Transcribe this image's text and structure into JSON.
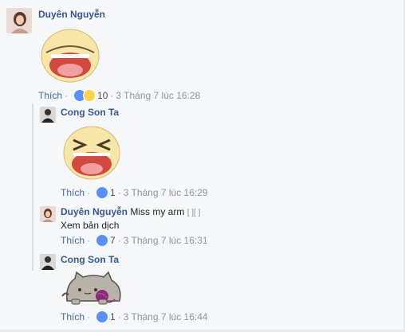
{
  "comments": [
    {
      "author": "Duyên Nguyễn",
      "like_label": "Thích",
      "reaction_count": "10",
      "timestamp": "3 Tháng 7 lúc 16:28",
      "sticker": "laughing-face-sticker"
    },
    {
      "author": "Cong Son Ta",
      "like_label": "Thích",
      "reaction_count": "1",
      "timestamp": "3 Tháng 7 lúc 16:29",
      "sticker": "squinting-laugh-face-sticker"
    },
    {
      "author": "Duyên Nguyễn",
      "text": "Miss my arm",
      "text_suffix": "[ ][ ]",
      "translate_label": "Xem bản dịch",
      "like_label": "Thích",
      "reaction_count": "7",
      "timestamp": "3 Tháng 7 lúc 16:31"
    },
    {
      "author": "Cong Son Ta",
      "like_label": "Thích",
      "reaction_count": "1",
      "timestamp": "3 Tháng 7 lúc 16:44",
      "sticker": "pusheen-cat-yarn-sticker"
    }
  ],
  "separator": "·",
  "colors": {
    "background": "#f6f7f9",
    "name": "#365899",
    "link": "#4267b2",
    "meta": "#90949c",
    "like_reaction": "#5890ff"
  }
}
